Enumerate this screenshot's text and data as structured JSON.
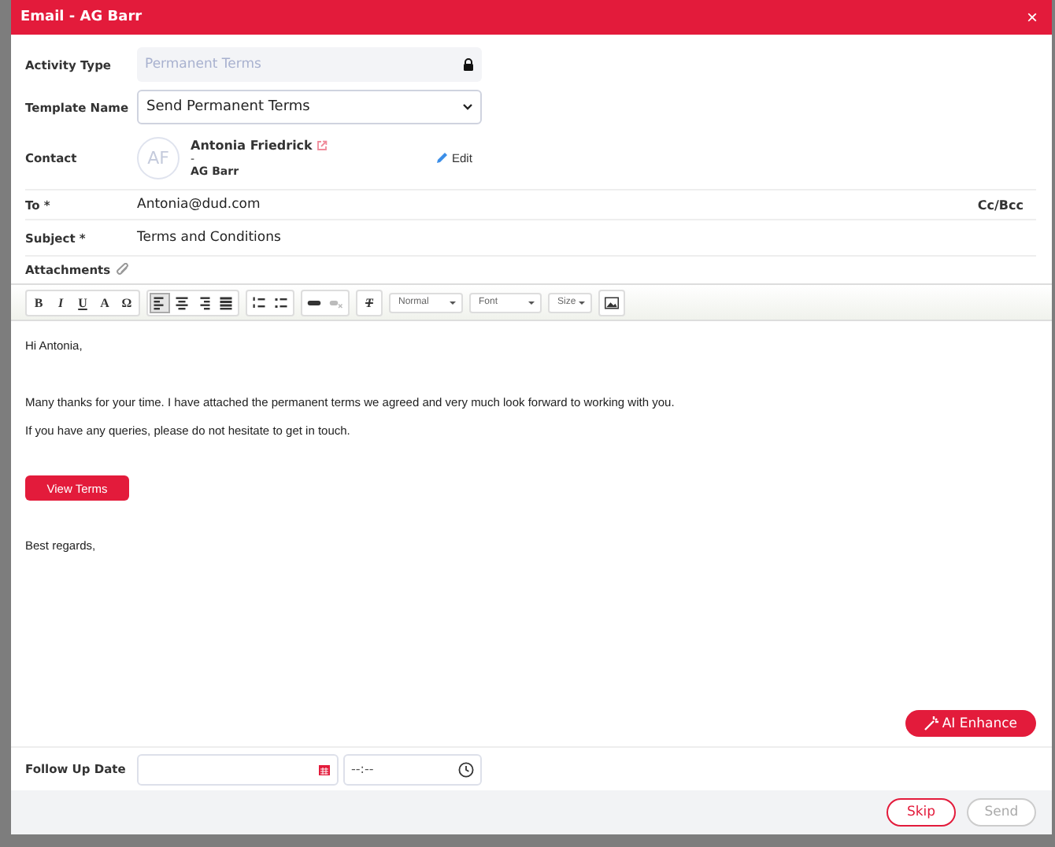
{
  "window": {
    "title": "Email - AG Barr",
    "close": "×"
  },
  "fields": {
    "activity_type": {
      "label": "Activity Type",
      "value": "Permanent Terms",
      "locked": true
    },
    "template_name": {
      "label": "Template Name",
      "value": "Send Permanent Terms"
    },
    "contact": {
      "label": "Contact",
      "initials": "AF",
      "name": "Antonia Friedrick",
      "role": "-",
      "company": "AG Barr",
      "edit": "Edit"
    },
    "to": {
      "label": "To *",
      "value": "Antonia@dud.com",
      "cc_bcc": "Cc/Bcc"
    },
    "subject": {
      "label": "Subject *",
      "value": "Terms and Conditions"
    },
    "attachments": {
      "label": "Attachments"
    }
  },
  "toolbar": {
    "items": [
      {
        "kind": "glyph",
        "label": "B",
        "selected": false,
        "disabled": false
      },
      {
        "kind": "glyph",
        "label": "I",
        "selected": false,
        "disabled": false
      },
      {
        "kind": "glyph",
        "label": "U",
        "selected": false,
        "disabled": false
      },
      {
        "kind": "glyph",
        "label": "A",
        "selected": false,
        "disabled": false
      },
      {
        "kind": "glyph",
        "label": "Ω",
        "selected": false,
        "disabled": false
      },
      {
        "kind": "icon",
        "selected": true,
        "disabled": false
      },
      {
        "kind": "icon",
        "selected": false,
        "disabled": false
      },
      {
        "kind": "icon",
        "selected": false,
        "disabled": false
      },
      {
        "kind": "icon",
        "selected": false,
        "disabled": false
      },
      {
        "kind": "icon",
        "selected": false,
        "disabled": false
      },
      {
        "kind": "icon",
        "selected": false,
        "disabled": false
      },
      {
        "kind": "icon",
        "selected": false,
        "disabled": false
      },
      {
        "kind": "icon",
        "selected": false,
        "disabled": true
      },
      {
        "kind": "glyph",
        "label": "T",
        "selected": false,
        "disabled": false
      }
    ],
    "dropdowns": [
      "Normal",
      "Font",
      "Size"
    ]
  },
  "body": [
    {
      "kind": "text",
      "text": "Hi Antonia,"
    },
    {
      "kind": "text",
      "text": "Many thanks for your time. I have attached the permanent terms we agreed and very much look forward to working with you."
    },
    {
      "kind": "text",
      "text": "If you have any queries, please do not hesitate to get in touch."
    },
    {
      "kind": "button",
      "text": "View Terms"
    },
    {
      "kind": "text",
      "text": "Best regards,"
    }
  ],
  "ai_button": "AI Enhance",
  "follow_up": {
    "label": "Follow Up Date",
    "time_placeholder": "--:--"
  },
  "footer": {
    "buttons": [
      {
        "label": "Skip",
        "disabled": false
      },
      {
        "label": "Send",
        "disabled": true
      }
    ]
  }
}
